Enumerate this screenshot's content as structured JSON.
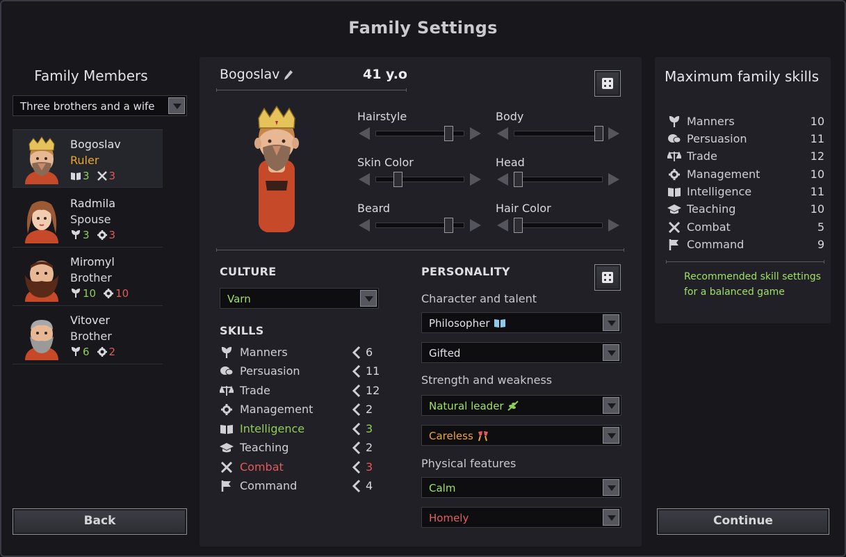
{
  "title": "Family Settings",
  "family": {
    "heading": "Family Members",
    "preset": "Three brothers and a wife",
    "members": [
      {
        "name": "Bogoslav",
        "role": "Ruler",
        "stat1": "3",
        "stat2": "3"
      },
      {
        "name": "Radmila",
        "role": "Spouse",
        "stat1": "3",
        "stat2": "3"
      },
      {
        "name": "Miromyl",
        "role": "Brother",
        "stat1": "10",
        "stat2": "10"
      },
      {
        "name": "Vitover",
        "role": "Brother",
        "stat1": "6",
        "stat2": "2"
      }
    ],
    "back_label": "Back"
  },
  "character": {
    "name": "Bogoslav",
    "age": "41 y.o",
    "sliders": [
      {
        "label": "Hairstyle",
        "value": 0.85
      },
      {
        "label": "Body",
        "value": 1.0
      },
      {
        "label": "Skin Color",
        "value": 0.22
      },
      {
        "label": "Head",
        "value": 0.0
      },
      {
        "label": "Beard",
        "value": 0.85
      },
      {
        "label": "Hair Color",
        "value": 0.0
      }
    ],
    "culture_heading": "CULTURE",
    "culture": "Varn",
    "skills_heading": "SKILLS",
    "skills": [
      {
        "name": "Manners",
        "value": "6",
        "icon": "manners-icon"
      },
      {
        "name": "Persuasion",
        "value": "11",
        "icon": "persuasion-icon"
      },
      {
        "name": "Trade",
        "value": "12",
        "icon": "trade-icon"
      },
      {
        "name": "Management",
        "value": "2",
        "icon": "management-icon"
      },
      {
        "name": "Intelligence",
        "value": "3",
        "icon": "intelligence-icon"
      },
      {
        "name": "Teaching",
        "value": "2",
        "icon": "teaching-icon"
      },
      {
        "name": "Combat",
        "value": "3",
        "icon": "combat-icon"
      },
      {
        "name": "Command",
        "value": "4",
        "icon": "command-icon"
      }
    ],
    "personality_heading": "PERSONALITY",
    "character_talent_label": "Character and talent",
    "character_trait": "Philosopher",
    "talent": "Gifted",
    "strength_weakness_label": "Strength and weakness",
    "strength": "Natural leader",
    "weakness": "Careless",
    "physical_label": "Physical features",
    "physical1": "Calm",
    "physical2": "Homely",
    "colors": {
      "green": "#9fe066",
      "orange": "#eda43a",
      "red": "#e06060",
      "gold": "#e8a62c"
    }
  },
  "max_skills": {
    "heading": "Maximum family skills",
    "rows": [
      {
        "name": "Manners",
        "value": "10"
      },
      {
        "name": "Persuasion",
        "value": "11"
      },
      {
        "name": "Trade",
        "value": "12"
      },
      {
        "name": "Management",
        "value": "10"
      },
      {
        "name": "Intelligence",
        "value": "11"
      },
      {
        "name": "Teaching",
        "value": "10"
      },
      {
        "name": "Combat",
        "value": "5"
      },
      {
        "name": "Command",
        "value": "9"
      }
    ],
    "recommendation": "Recommended skill settings for a balanced game",
    "continue_label": "Continue"
  }
}
